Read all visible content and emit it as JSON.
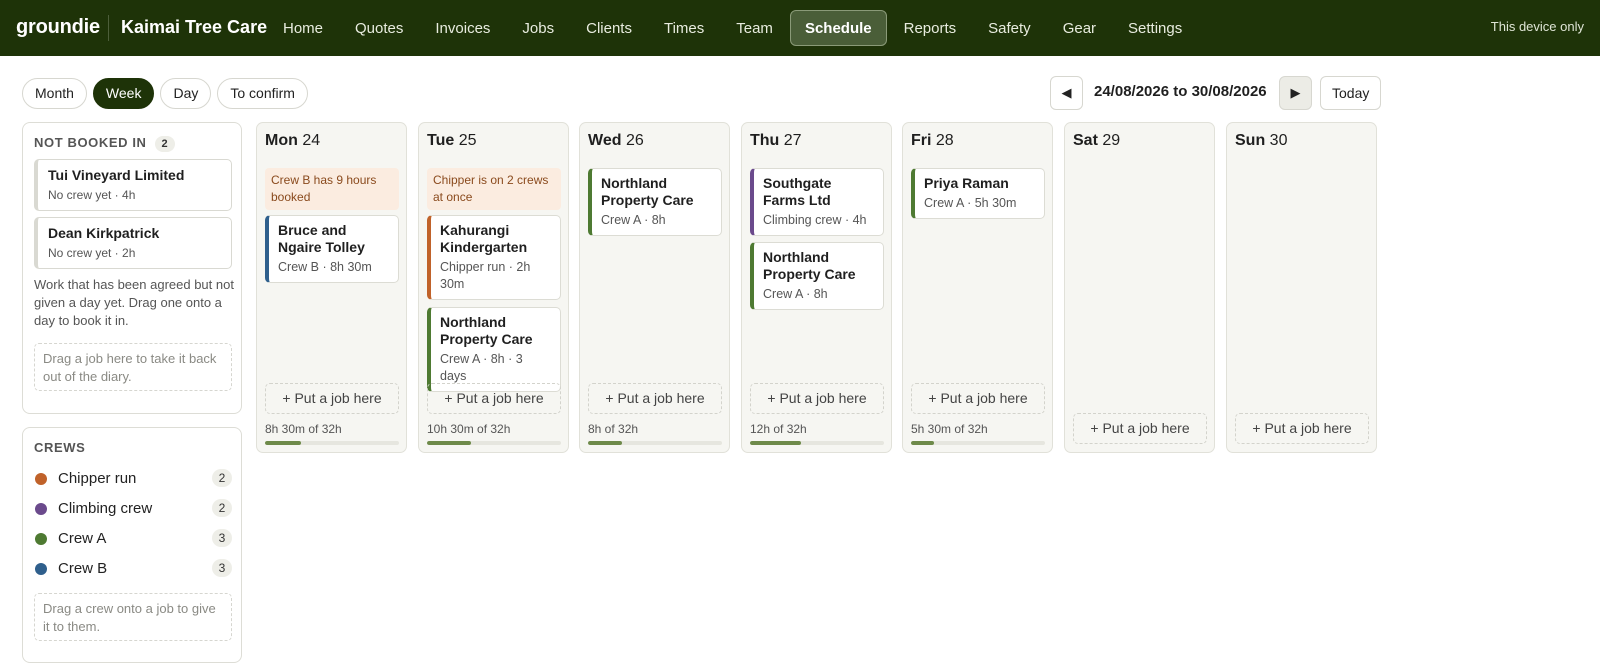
{
  "brand": "groundie",
  "company": "Kaimai Tree Care",
  "nav": [
    "Home",
    "Quotes",
    "Invoices",
    "Jobs",
    "Clients",
    "Times",
    "Team",
    "Schedule",
    "Reports",
    "Safety",
    "Gear",
    "Settings"
  ],
  "nav_active": "Schedule",
  "device_note": "This device only",
  "views": [
    "Month",
    "Week",
    "Day",
    "To confirm"
  ],
  "view_active": "Week",
  "date_range": "24/08/2026 to 30/08/2026",
  "prev_glyph": "◀",
  "next_glyph": "▶",
  "today_label": "Today",
  "not_booked": {
    "title": "NOT BOOKED IN",
    "count": "2",
    "items": [
      {
        "title": "Tui Vineyard Limited",
        "meta": "No crew yet · 4h"
      },
      {
        "title": "Dean Kirkpatrick",
        "meta": "No crew yet · 2h"
      }
    ],
    "note": "Work that has been agreed but not given a day yet. Drag one onto a day to book it in.",
    "dropzone": "Drag a job here to take it back out of the diary."
  },
  "crews": {
    "title": "CREWS",
    "items": [
      {
        "name": "Chipper run",
        "color": "#c0622a",
        "count": "2"
      },
      {
        "name": "Climbing crew",
        "color": "#6b4a8c",
        "count": "2"
      },
      {
        "name": "Crew A",
        "color": "#4e7a32",
        "count": "3"
      },
      {
        "name": "Crew B",
        "color": "#2f5f8c",
        "count": "3"
      }
    ],
    "dropzone": "Drag a crew onto a job to give it to them."
  },
  "put_job_label": "+ Put a job here",
  "days": [
    {
      "dow": "Mon",
      "num": "24",
      "warning": "Crew B has 9 hours booked",
      "jobs": [
        {
          "title": "Bruce and Ngaire Tolley",
          "meta": "Crew B · 8h 30m",
          "color": "#2f5f8c"
        }
      ],
      "load": "8h 30m of 32h",
      "load_fraction": 0.27
    },
    {
      "dow": "Tue",
      "num": "25",
      "warning": "Chipper is on 2 crews at once",
      "jobs": [
        {
          "title": "Kahurangi Kindergarten",
          "meta": "Chipper run · 2h 30m",
          "color": "#c0622a"
        },
        {
          "title": "Northland Property Care",
          "meta": "Crew A · 8h · 3 days",
          "color": "#4e7a32"
        }
      ],
      "load": "10h 30m of 32h",
      "load_fraction": 0.33
    },
    {
      "dow": "Wed",
      "num": "26",
      "warning": "",
      "jobs": [
        {
          "title": "Northland Property Care",
          "meta": "Crew A · 8h",
          "color": "#4e7a32"
        }
      ],
      "load": "8h of 32h",
      "load_fraction": 0.25
    },
    {
      "dow": "Thu",
      "num": "27",
      "warning": "",
      "jobs": [
        {
          "title": "Southgate Farms Ltd",
          "meta": "Climbing crew · 4h",
          "color": "#6b4a8c"
        },
        {
          "title": "Northland Property Care",
          "meta": "Crew A · 8h",
          "color": "#4e7a32"
        }
      ],
      "load": "12h of 32h",
      "load_fraction": 0.38
    },
    {
      "dow": "Fri",
      "num": "28",
      "warning": "",
      "jobs": [
        {
          "title": "Priya Raman",
          "meta": "Crew A · 5h 30m",
          "color": "#4e7a32"
        }
      ],
      "load": "5h 30m of 32h",
      "load_fraction": 0.17
    },
    {
      "dow": "Sat",
      "num": "29",
      "warning": "",
      "jobs": [],
      "load": "",
      "load_fraction": null
    },
    {
      "dow": "Sun",
      "num": "30",
      "warning": "",
      "jobs": [],
      "load": "",
      "load_fraction": null
    }
  ]
}
